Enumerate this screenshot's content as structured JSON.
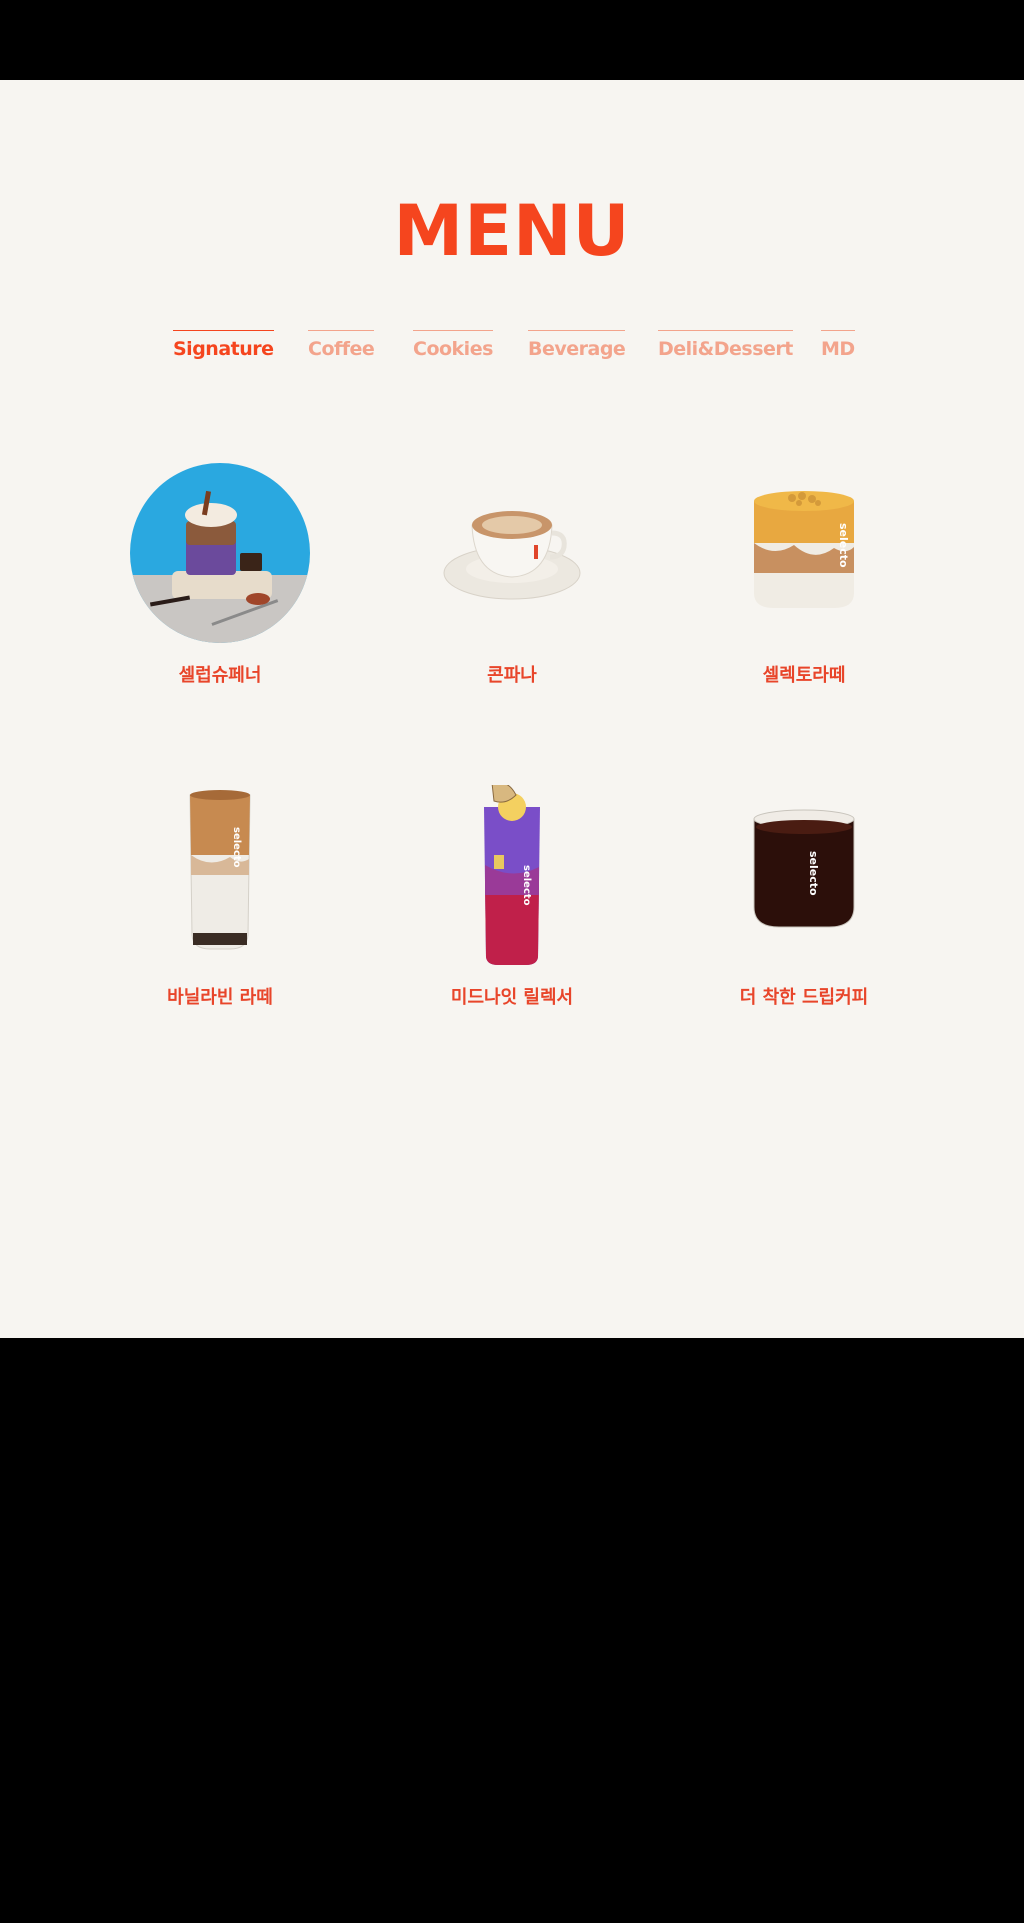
{
  "title": "MENU",
  "colors": {
    "accent": "#f5451e",
    "tab_inactive": "#f3a48c",
    "label": "#e8452a",
    "background": "#f7f5f1"
  },
  "tabs": [
    {
      "label": "Signature",
      "active": true
    },
    {
      "label": "Coffee",
      "active": false
    },
    {
      "label": "Cookies",
      "active": false
    },
    {
      "label": "Beverage",
      "active": false
    },
    {
      "label": "Deli&Dessert",
      "active": false
    },
    {
      "label": "MD",
      "active": false
    }
  ],
  "items": [
    {
      "name": "셀럽슈페너",
      "image": "celeb-einspanner-photo"
    },
    {
      "name": "콘파나",
      "image": "con-panna-cup"
    },
    {
      "name": "셀렉토라떼",
      "image": "selecto-latte-glass"
    },
    {
      "name": "바닐라빈 라떼",
      "image": "vanilla-bean-latte-glass"
    },
    {
      "name": "미드나잇 릴렉서",
      "image": "midnight-relaxer-glass"
    },
    {
      "name": "더 착한 드립커피",
      "image": "drip-coffee-glass"
    }
  ],
  "glass_brand": "selecto"
}
